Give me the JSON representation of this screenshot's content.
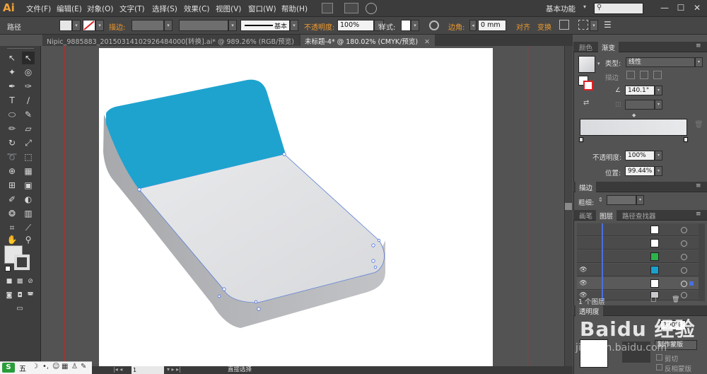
{
  "app": {
    "logo": "Ai",
    "menus": [
      "文件(F)",
      "编辑(E)",
      "对象(O)",
      "文字(T)",
      "选择(S)",
      "效果(C)",
      "视图(V)",
      "窗口(W)",
      "帮助(H)"
    ],
    "workspace": "基本功能",
    "window_buttons": [
      "—",
      "☐",
      "✕"
    ]
  },
  "controlbar": {
    "object_label": "路径",
    "stroke_label": "描边:",
    "stroke_style_label": "基本",
    "opacity_label": "不透明度:",
    "opacity_value": "100%",
    "style_label": "样式:",
    "corner_label": "边角:",
    "corner_value": "0 mm",
    "align_label": "对齐",
    "transform_label": "变换"
  },
  "tabs": [
    {
      "label": "Nipic_9885883_20150314102926484000[转换].ai* @ 989.26% (RGB/预览)",
      "close": "✕"
    },
    {
      "label": "未标题-4* @ 180.02% (CMYK/预览)",
      "close": "✕"
    }
  ],
  "statusbar": {
    "zoom": "1",
    "status": "直接选择"
  },
  "ime": {
    "logo": "S",
    "text": "五",
    "icons": [
      "☽",
      "•,",
      "☺",
      "▦",
      "♙",
      "✎"
    ]
  },
  "panels": {
    "color_tabs": [
      "颜色",
      "渐变"
    ],
    "gradient": {
      "type_label": "类型:",
      "type_value": "线性",
      "stroke_label": "描边",
      "angle_value": "140.1°",
      "opacity_label": "不透明度:",
      "opacity_value": "100%",
      "position_label": "位置:",
      "position_value": "99.44%",
      "colors": {
        "start": "#d9dadd",
        "end": "#e8e9eb"
      }
    },
    "stroke_panel": {
      "title": "描边",
      "weight_label": "粗细:"
    },
    "layer_tabs": [
      "画笔",
      "图层",
      "路径查找器"
    ],
    "layers_footer": "1 个图层",
    "layers": [
      {
        "visible": false,
        "thumb": "#ffffff"
      },
      {
        "visible": false,
        "thumb": "#ffffff"
      },
      {
        "visible": false,
        "thumb": "#2cb34a"
      },
      {
        "visible": true,
        "thumb": "#1aa0cc"
      },
      {
        "visible": true,
        "thumb": "#ffffff"
      },
      {
        "visible": true,
        "thumb": "#c8c9cc"
      }
    ],
    "bottom_tab": "透明度",
    "bottom_opacity": "100%",
    "mask_button": "制作蒙版",
    "clip_label": "剪切",
    "invert_label": "反相蒙版"
  },
  "artwork": {
    "top_color": "#1ea3cf",
    "face_color": "#dfe0e3",
    "side_color": "#b9babd"
  },
  "watermark": "Baidu 经验",
  "watermark_sub": "jingyan.baidu.com"
}
